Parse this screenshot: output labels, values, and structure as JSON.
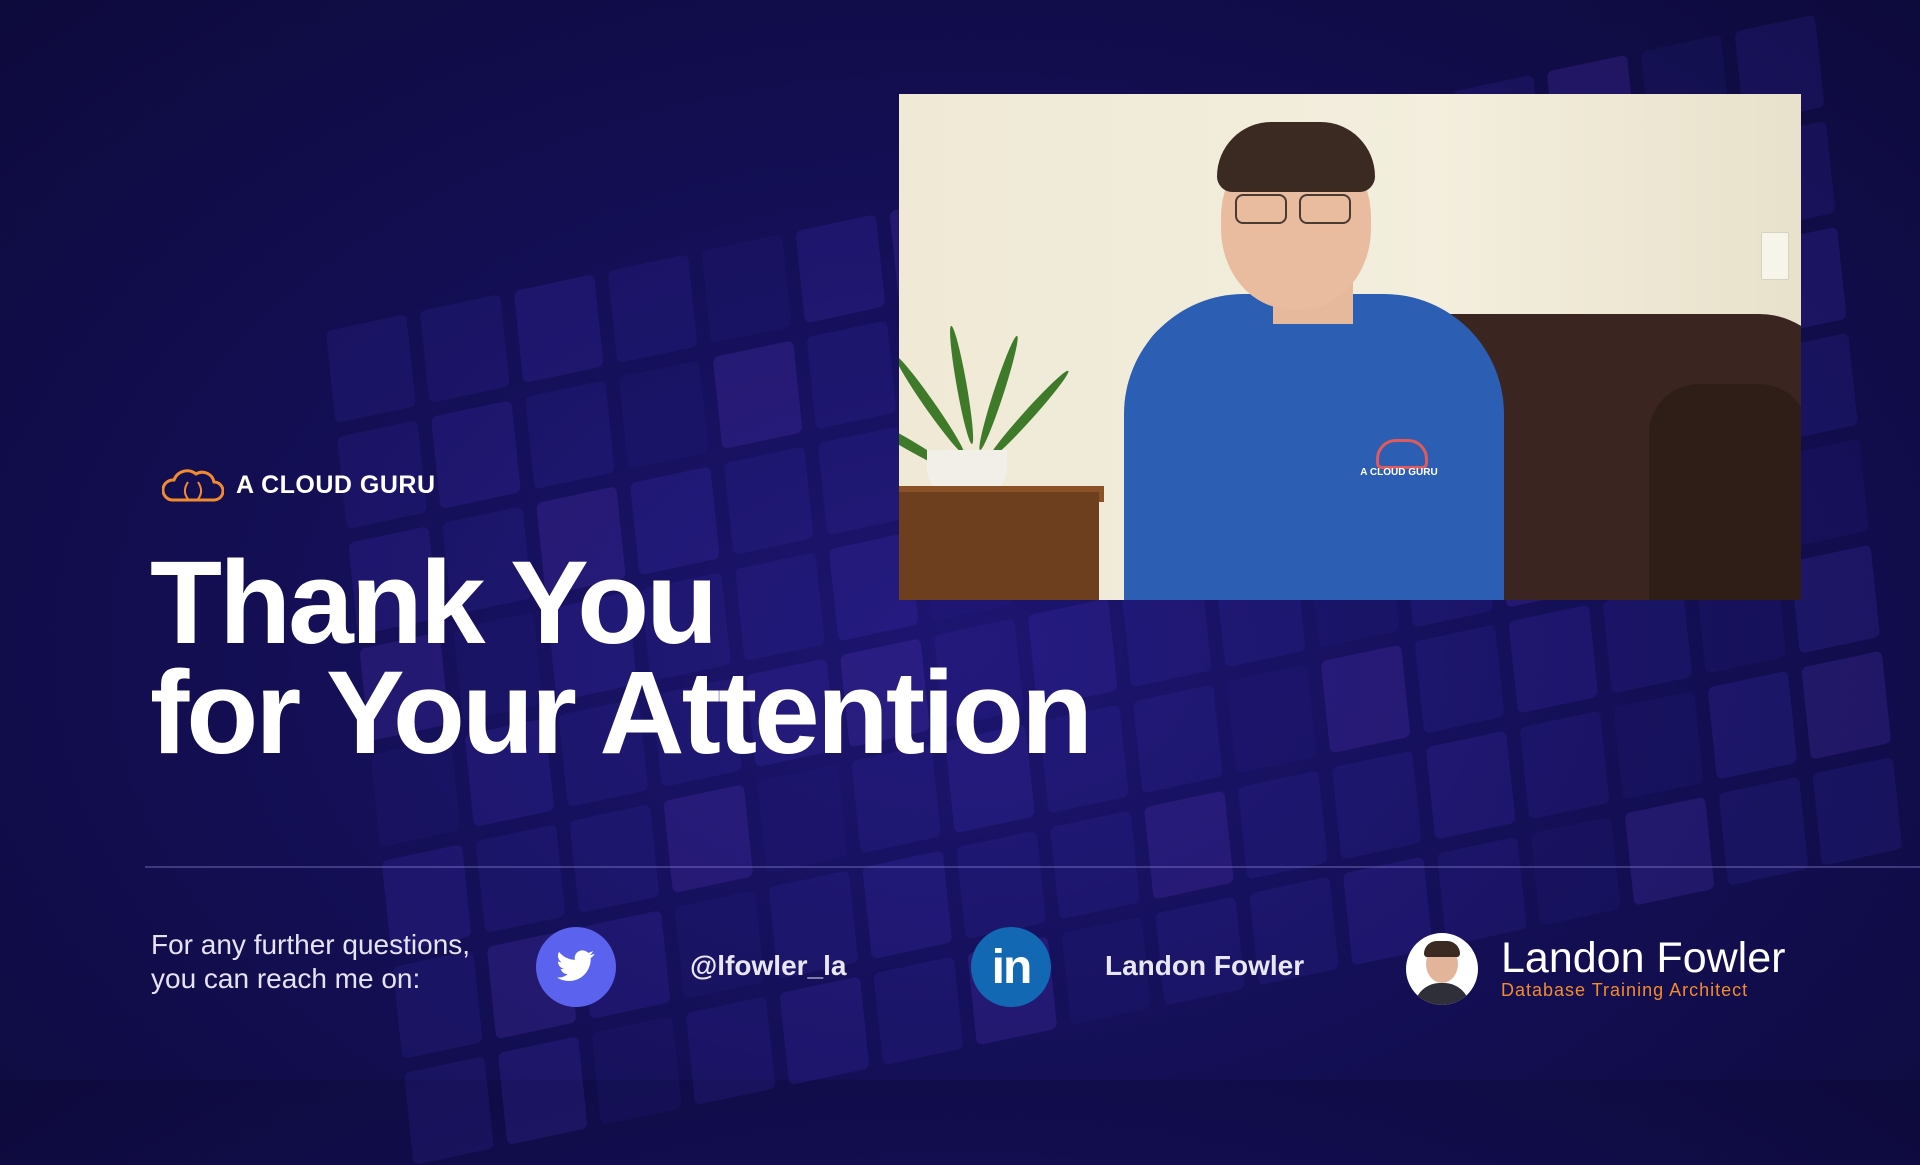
{
  "brand": {
    "name": "A CLOUD GURU",
    "logo_color": "#f28b30"
  },
  "title": {
    "line1": "Thank You",
    "line2": "for Your Attention"
  },
  "contact": {
    "prompt_line1": "For any further questions,",
    "prompt_line2": "you can reach me on:",
    "twitter": {
      "icon": "twitter-bird-icon",
      "handle": "@lfowler_la",
      "color": "#5b63ee"
    },
    "linkedin": {
      "icon": "linkedin-icon",
      "glyph": "in",
      "handle": "Landon Fowler",
      "color": "#1268b3"
    }
  },
  "presenter": {
    "name": "Landon Fowler",
    "role": "Database Training Architect",
    "role_color": "#f28b30"
  },
  "video": {
    "shirt_logo_text": "A CLOUD GURU"
  }
}
